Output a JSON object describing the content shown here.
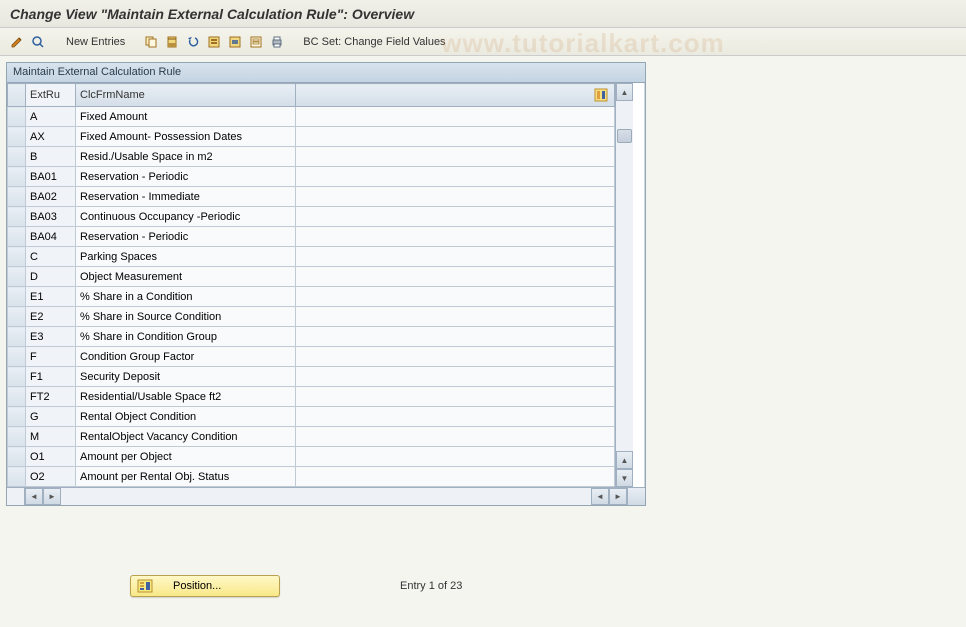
{
  "header": {
    "title": "Change View \"Maintain External Calculation Rule\": Overview"
  },
  "toolbar": {
    "new_entries_label": "New Entries",
    "bc_set_label": "BC Set: Change Field Values"
  },
  "table": {
    "title": "Maintain External Calculation Rule",
    "columns": {
      "extru": "ExtRu",
      "clcfrmname": "ClcFrmName"
    },
    "rows": [
      {
        "extru": "A",
        "name": "Fixed Amount"
      },
      {
        "extru": "AX",
        "name": "Fixed Amount- Possession Dates"
      },
      {
        "extru": "B",
        "name": "Resid./Usable Space in m2"
      },
      {
        "extru": "BA01",
        "name": "Reservation - Periodic"
      },
      {
        "extru": "BA02",
        "name": "Reservation - Immediate"
      },
      {
        "extru": "BA03",
        "name": "Continuous Occupancy -Periodic"
      },
      {
        "extru": "BA04",
        "name": "Reservation - Periodic"
      },
      {
        "extru": "C",
        "name": "Parking Spaces"
      },
      {
        "extru": "D",
        "name": "Object Measurement"
      },
      {
        "extru": "E1",
        "name": "% Share in a Condition"
      },
      {
        "extru": "E2",
        "name": "% Share in Source Condition"
      },
      {
        "extru": "E3",
        "name": "% Share in Condition Group"
      },
      {
        "extru": "F",
        "name": "Condition Group Factor"
      },
      {
        "extru": "F1",
        "name": "Security Deposit"
      },
      {
        "extru": "FT2",
        "name": "Residential/Usable Space ft2"
      },
      {
        "extru": "G",
        "name": "Rental Object Condition"
      },
      {
        "extru": "M",
        "name": "RentalObject Vacancy Condition"
      },
      {
        "extru": "O1",
        "name": "Amount per Object"
      },
      {
        "extru": "O2",
        "name": "Amount per Rental Obj. Status"
      }
    ]
  },
  "footer": {
    "position_label": "Position...",
    "entry_text": "Entry 1 of 23"
  },
  "watermark_text": "www.tutorialkart.com"
}
